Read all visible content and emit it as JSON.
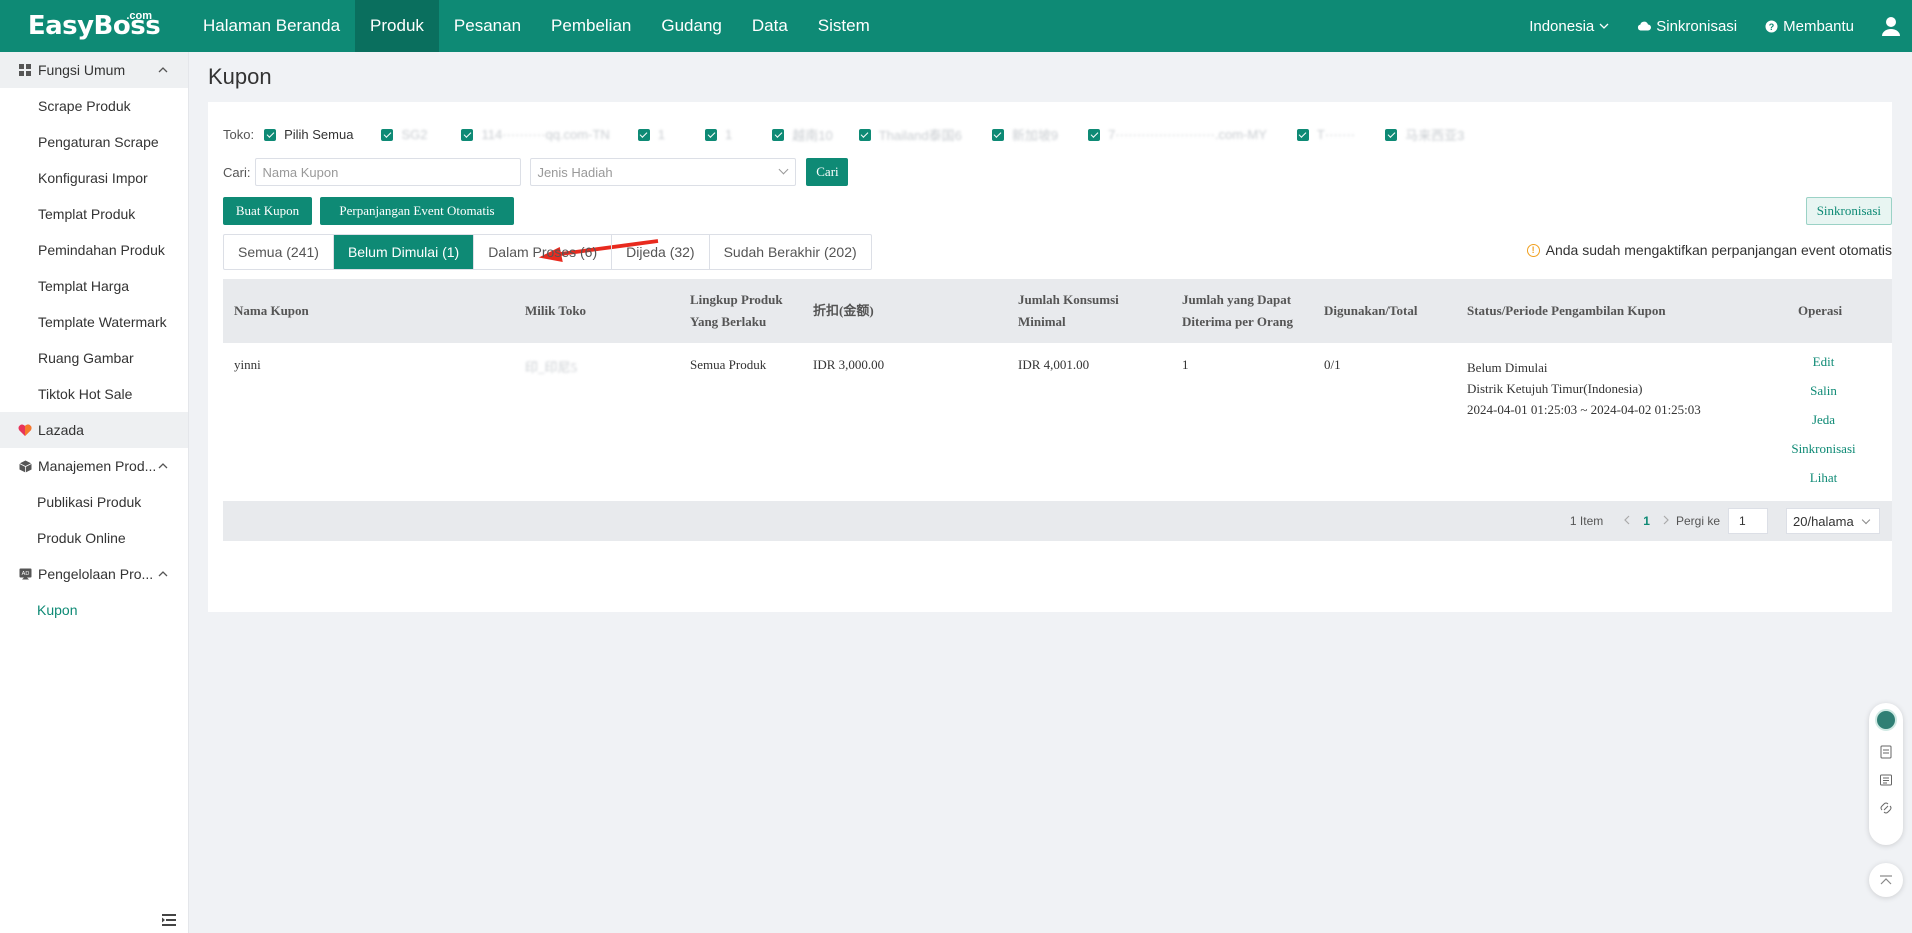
{
  "brand": {
    "logo_text": "EasyBoss",
    "logo_suffix": ".com"
  },
  "topnav": {
    "items": [
      "Halaman Beranda",
      "Produk",
      "Pesanan",
      "Pembelian",
      "Gudang",
      "Data",
      "Sistem"
    ],
    "active": "Produk",
    "right": {
      "country": "Indonesia",
      "sync": "Sinkronisasi",
      "help": "Membantu"
    }
  },
  "sidebar": {
    "group_general": "Fungsi Umum",
    "general_items": [
      "Scrape Produk",
      "Pengaturan Scrape",
      "Konfigurasi Impor",
      "Templat Produk",
      "Pemindahan Produk",
      "Templat Harga",
      "Template Watermark",
      "Ruang Gambar",
      "Tiktok Hot Sale"
    ],
    "group_lazada": "Lazada",
    "group_product_mgmt": "Manajemen Prod...",
    "product_mgmt_items": [
      "Publikasi Produk",
      "Produk Online"
    ],
    "group_promo": "Pengelolaan Pro...",
    "promo_items": [
      "Kupon"
    ],
    "active_item": "Kupon"
  },
  "page": {
    "title": "Kupon",
    "store_label": "Toko:",
    "select_all": "Pilih Semua",
    "stores": [
      "SG2",
      "114··········qq.com-TN",
      "1",
      "1",
      "越南10",
      "Thailand泰国6",
      "新加坡9",
      "7·······················.com-MY",
      "T·······",
      "马来西亚3"
    ],
    "search_label": "Cari:",
    "coupon_name_placeholder": "Nama Kupon",
    "reward_type_placeholder": "Jenis Hadiah",
    "search_button": "Cari",
    "create_button": "Buat Kupon",
    "auto_extend_button": "Perpanjangan Event Otomatis",
    "sync_button": "Sinkronisasi",
    "notice": "Anda sudah mengaktifkan perpanjangan event otomatis",
    "tabs": [
      "Semua (241)",
      "Belum Dimulai (1)",
      "Dalam Proses (6)",
      "Dijeda (32)",
      "Sudah Berakhir (202)"
    ],
    "active_tab": "Belum Dimulai (1)"
  },
  "table": {
    "headers": {
      "name": "Nama Kupon",
      "store": "Milik Toko",
      "scope_line1": "Lingkup Produk",
      "scope_line2": "Yang Berlaku",
      "discount": "折扣(金额)",
      "min_line1": "Jumlah Konsumsi",
      "min_line2": "Minimal",
      "per_person_line1": "Jumlah yang Dapat",
      "per_person_line2": "Diterima per Orang",
      "used": "Digunakan/Total",
      "status": "Status/Periode Pengambilan Kupon",
      "ops": "Operasi"
    },
    "rows": [
      {
        "name": "yinni",
        "store": "印_印尼5",
        "scope": "Semua Produk",
        "discount": "IDR 3,000.00",
        "min_spend": "IDR 4,001.00",
        "per_person": "1",
        "used": "0/1",
        "status": "Belum Dimulai",
        "region": "Distrik Ketujuh Timur(Indonesia)",
        "period": "2024-04-01 01:25:03 ~ 2024-04-02 01:25:03",
        "ops": [
          "Edit",
          "Salin",
          "Jeda",
          "Sinkronisasi",
          "Lihat"
        ]
      }
    ]
  },
  "pager": {
    "total": "1 Item",
    "current": "1",
    "goto_label": "Pergi ke",
    "goto_value": "1",
    "page_size": "20/halama"
  }
}
